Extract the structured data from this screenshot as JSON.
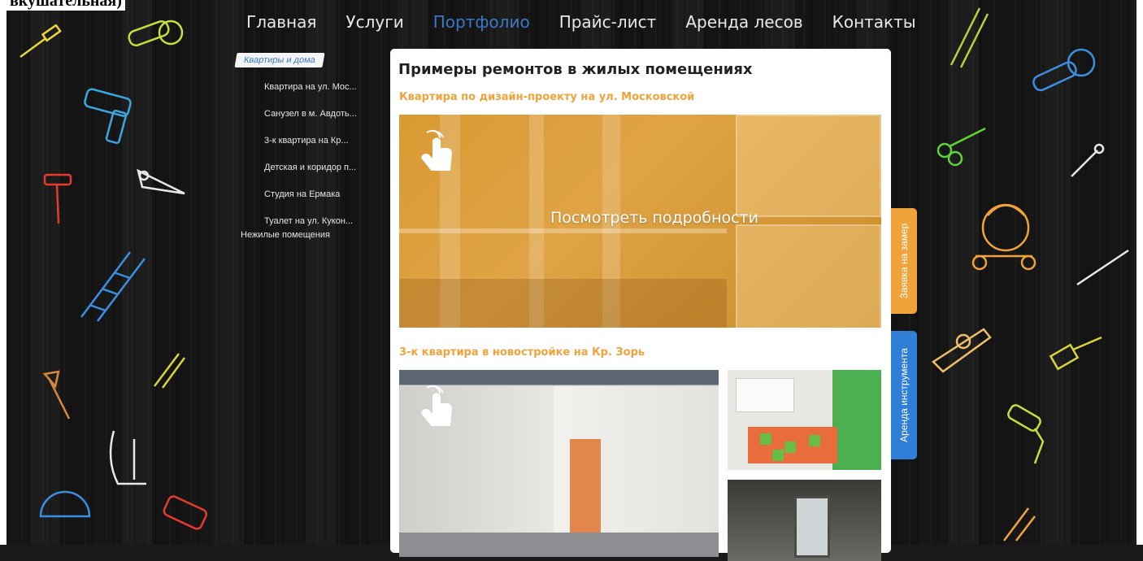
{
  "frame_label": "вкушательная)",
  "nav": {
    "items": [
      {
        "label": "Главная",
        "active": false
      },
      {
        "label": "Услуги",
        "active": false
      },
      {
        "label": "Портфолио",
        "active": true
      },
      {
        "label": "Прайс-лист",
        "active": false
      },
      {
        "label": "Аренда лесов",
        "active": false
      },
      {
        "label": "Контакты",
        "active": false
      }
    ]
  },
  "sidebar": {
    "active": "Квартиры и дома",
    "items": [
      "Квартира на ул. Мос...",
      "Санузел в м. Авдоть...",
      "3-к квартира на Кр...",
      "Детская и коридор п...",
      "Студия на Ермака",
      "Туалет на ул. Кукон..."
    ],
    "other": "Нежилые помещения"
  },
  "content": {
    "title": "Примеры ремонтов в жилых помещениях",
    "projects": [
      {
        "title": "Квартира по дизайн-проекту на ул. Московской",
        "overlay": "Посмотреть подробности"
      },
      {
        "title": "3-к квартира в новостройке на Кр. Зорь"
      }
    ]
  },
  "tabs": {
    "request": "Заявка на замер",
    "rent": "Аренда инструмента"
  },
  "colors": {
    "accent_orange": "#f0a33a",
    "accent_blue": "#2f7fd6",
    "nav_active": "#3a78c8"
  }
}
